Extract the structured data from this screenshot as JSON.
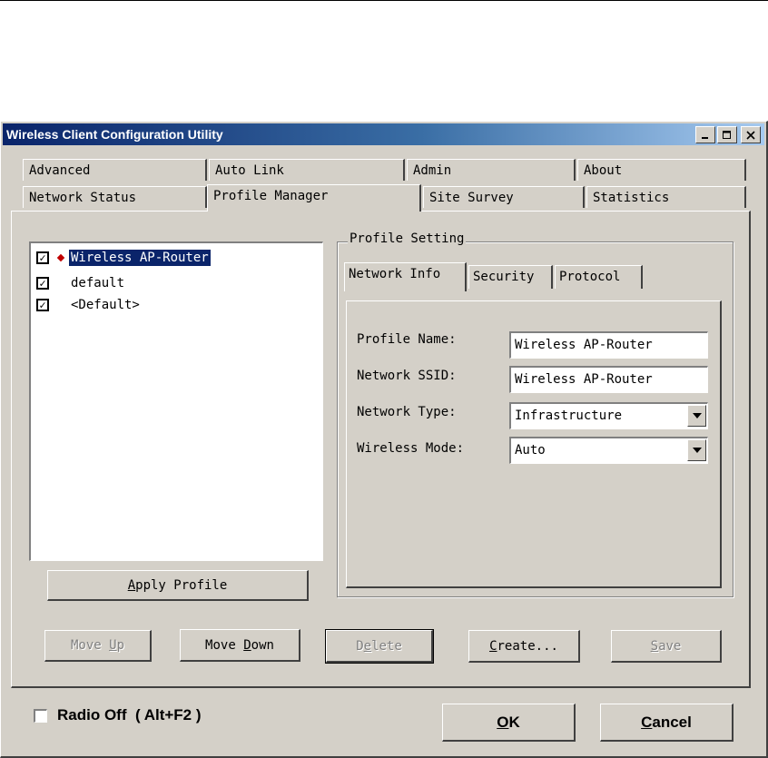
{
  "window": {
    "title": "Wireless Client Configuration Utility"
  },
  "tabs": {
    "row1": [
      "Advanced",
      "Auto Link",
      "Admin",
      "About"
    ],
    "row2": [
      "Network Status",
      "Profile Manager",
      "Site Survey",
      "Statistics"
    ],
    "selected": "Profile Manager"
  },
  "profiles": [
    {
      "label": "Wireless AP-Router",
      "checked": true,
      "active": true
    },
    {
      "label": "default",
      "checked": true,
      "active": false
    },
    {
      "label": "<Default>",
      "checked": true,
      "active": false
    }
  ],
  "apply_profile": {
    "pre": "",
    "ul": "A",
    "post": "pply Profile"
  },
  "profile_setting": {
    "group_label": "Profile Setting",
    "subtabs": [
      "Network Info",
      "Security",
      "Protocol"
    ],
    "fields": {
      "profile_name_label": "Profile Name:",
      "profile_name_value": "Wireless AP-Router",
      "network_ssid_label": "Network SSID:",
      "network_ssid_value": "Wireless AP-Router",
      "network_type_label": "Network Type:",
      "network_type_value": "Infrastructure",
      "wireless_mode_label": "Wireless Mode:",
      "wireless_mode_value": "Auto"
    }
  },
  "actions": {
    "move_up": {
      "pre": "Move ",
      "ul": "U",
      "post": "p"
    },
    "move_down": {
      "pre": "Move ",
      "ul": "D",
      "post": "own"
    },
    "delete": {
      "pre": "D",
      "ul": "e",
      "post": "lete"
    },
    "create": {
      "pre": "",
      "ul": "C",
      "post": "reate..."
    },
    "save": {
      "pre": "",
      "ul": "S",
      "post": "ave"
    }
  },
  "footer": {
    "radio_off": "Radio Off  ( Alt+F2 )",
    "ok": {
      "pre": "",
      "ul": "O",
      "post": "K"
    },
    "cancel": {
      "pre": "",
      "ul": "C",
      "post": "ancel"
    }
  },
  "icons": {
    "check": "check-icon",
    "active": "diamond-icon",
    "dropdown": "triangle-down-icon"
  }
}
